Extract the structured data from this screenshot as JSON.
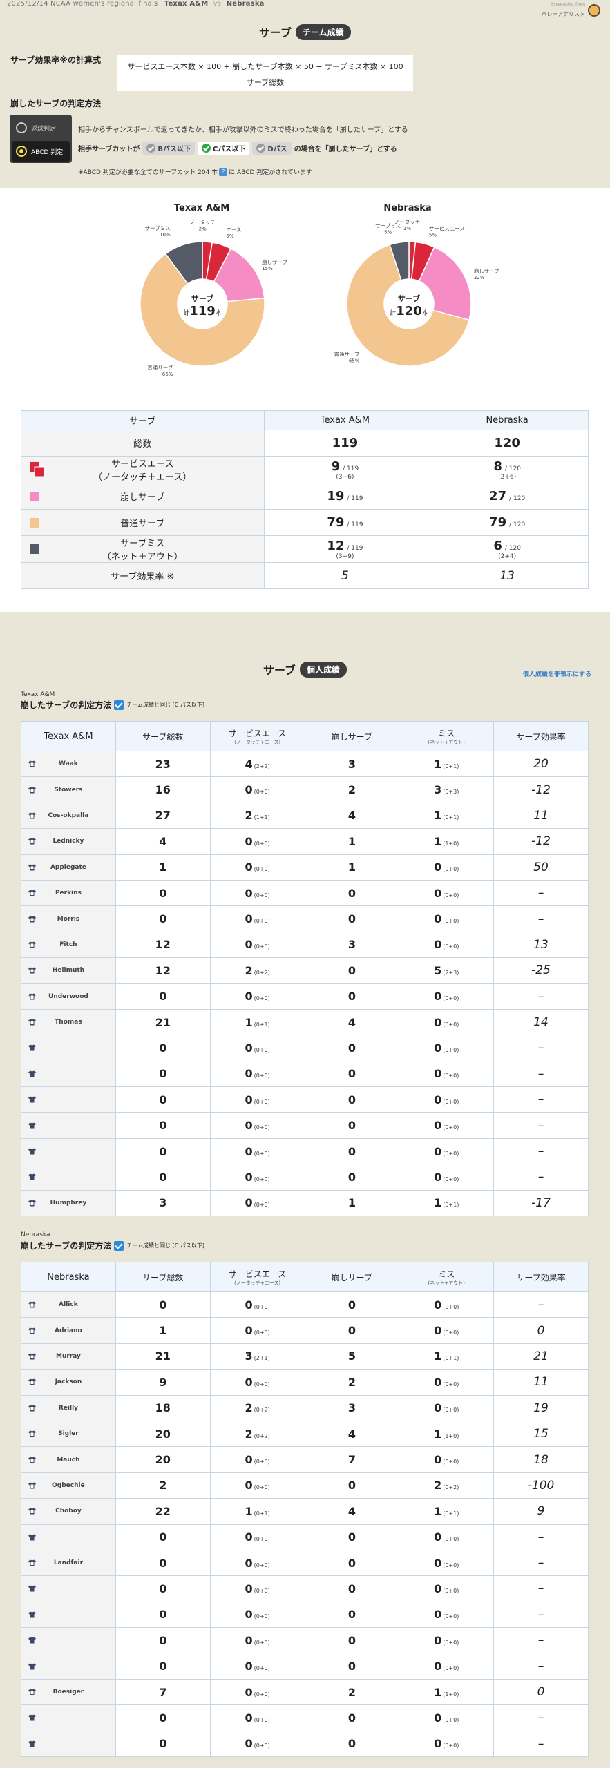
{
  "topbar": {
    "match": "2025/12/14 NCAA women's regional finals",
    "team_a": "Texax A&M",
    "vs": "vs",
    "team_b": "Nebraska"
  },
  "brand": {
    "small": "Screenshot from",
    "name": "バレーアナリスト"
  },
  "team_section": {
    "title": "サーブ",
    "badge": "チーム成績"
  },
  "formula": {
    "label": "サーブ効果率※の計算式",
    "numerator": "サービスエース本数 × 100 + 崩したサーブ本数 × 50 − サーブミス本数 × 100",
    "denominator": "サーブ総数"
  },
  "judge": {
    "label": "崩したサーブの判定方法",
    "modes": [
      "返球判定",
      "ABCD 判定"
    ],
    "active_mode": 1,
    "rule1": "相手からチャンスボールで返ってきたか、相手が攻撃以外のミスで終わった場合を「崩したサーブ」とする",
    "rule2_prefix": "相手サーブカットが",
    "chips": [
      "Bパス以下",
      "Cパス以下",
      "Dパス"
    ],
    "rule2_suffix": "の場合を「崩したサーブ」とする",
    "note_prefix": "※ABCD 判定が必要な全てのサーブカット 204 本",
    "note_icon": "?",
    "note_suffix": "に ABCD 判定がされています"
  },
  "colors": {
    "ace": "#d9263a",
    "break": "#f58dc4",
    "normal": "#f3c68f",
    "miss": "#545b67"
  },
  "pies": [
    {
      "team": "Texax A&M",
      "center_label": "サーブ",
      "total_prefix": "計",
      "total": "119",
      "total_suffix": "本",
      "chart_data": {
        "type": "pie",
        "categories": [
          "ノータッチ",
          "エース",
          "崩しサーブ",
          "普通サーブ",
          "サーブミス"
        ],
        "values": [
          3,
          6,
          19,
          79,
          12
        ]
      },
      "labels": [
        {
          "text": "ノータッチ",
          "pct": "2%"
        },
        {
          "text": "エース",
          "pct": "5%"
        },
        {
          "text": "崩しサーブ",
          "pct": "15%"
        },
        {
          "text": "普通サーブ",
          "pct": "66%"
        },
        {
          "text": "サーブミス",
          "pct": "10%"
        }
      ]
    },
    {
      "team": "Nebraska",
      "center_label": "サーブ",
      "total_prefix": "計",
      "total": "120",
      "total_suffix": "本",
      "chart_data": {
        "type": "pie",
        "categories": [
          "ノータッチ",
          "エース",
          "崩しサーブ",
          "普通サーブ",
          "サーブミス"
        ],
        "values": [
          2,
          6,
          27,
          79,
          6
        ]
      },
      "labels": [
        {
          "text": "ノータッチ",
          "pct": "1%"
        },
        {
          "text": "サービスエース",
          "pct": "5%"
        },
        {
          "text": "崩しサーブ",
          "pct": "22%"
        },
        {
          "text": "普通サーブ",
          "pct": "65%"
        },
        {
          "text": "サーブミス",
          "pct": "5%"
        }
      ]
    }
  ],
  "summary": {
    "headers": [
      "サーブ",
      "Texax A&M",
      "Nebraska"
    ],
    "rows": [
      {
        "label": "総数",
        "a": "119",
        "a_den": "",
        "a_sub": "",
        "b": "120",
        "b_den": "",
        "b_sub": "",
        "swatch": ""
      },
      {
        "label": "サービスエース",
        "label2": "（ノータッチ＋エース）",
        "a": "9",
        "a_den": "/ 119",
        "a_sub": "(3+6)",
        "b": "8",
        "b_den": "/ 120",
        "b_sub": "(2+6)",
        "swatch": "ace"
      },
      {
        "label": "崩しサーブ",
        "a": "19",
        "a_den": "/ 119",
        "a_sub": "",
        "b": "27",
        "b_den": "/ 120",
        "b_sub": "",
        "swatch": "break"
      },
      {
        "label": "普通サーブ",
        "a": "79",
        "a_den": "/ 119",
        "a_sub": "",
        "b": "79",
        "b_den": "/ 120",
        "b_sub": "",
        "swatch": "normal"
      },
      {
        "label": "サーブミス",
        "label2": "（ネット＋アウト）",
        "a": "12",
        "a_den": "/ 119",
        "a_sub": "(3+9)",
        "b": "6",
        "b_den": "/ 120",
        "b_sub": "(2+4)",
        "swatch": "miss"
      },
      {
        "label": "サーブ効果率 ※",
        "a": "5",
        "a_den": "",
        "a_sub": "",
        "b": "13",
        "b_den": "",
        "b_sub": "",
        "swatch": "",
        "italic": true
      }
    ]
  },
  "individual": {
    "title": "サーブ",
    "badge": "個人成績",
    "hide_link": "個人成績を非表示にする",
    "rule_label": "崩したサーブの判定方法",
    "checkbox_label": "チーム成績と同じ [C パス以下]",
    "col_headers": [
      "サーブ総数",
      "サービスエース",
      "崩しサーブ",
      "ミス",
      "サーブ効果率"
    ],
    "col_subs": [
      "",
      "(ノータッチ+エース)",
      "",
      "(ネット+アウト)",
      ""
    ],
    "teams": [
      {
        "caption": "Texax A&M",
        "header": "Texax A&M",
        "players": [
          {
            "name": "Waak",
            "total": "23",
            "ace": "4",
            "ace_s": "(2+2)",
            "brk": "3",
            "miss": "1",
            "miss_s": "(0+1)",
            "eff": "20"
          },
          {
            "name": "Stowers",
            "total": "16",
            "ace": "0",
            "ace_s": "(0+0)",
            "brk": "2",
            "miss": "3",
            "miss_s": "(0+3)",
            "eff": "-12"
          },
          {
            "name": "Cos-okpalla",
            "total": "27",
            "ace": "2",
            "ace_s": "(1+1)",
            "brk": "4",
            "miss": "1",
            "miss_s": "(0+1)",
            "eff": "11"
          },
          {
            "name": "Lednicky",
            "total": "4",
            "ace": "0",
            "ace_s": "(0+0)",
            "brk": "1",
            "miss": "1",
            "miss_s": "(1+0)",
            "eff": "-12"
          },
          {
            "name": "Applegate",
            "total": "1",
            "ace": "0",
            "ace_s": "(0+0)",
            "brk": "1",
            "miss": "0",
            "miss_s": "(0+0)",
            "eff": "50"
          },
          {
            "name": "Perkins",
            "total": "0",
            "ace": "0",
            "ace_s": "(0+0)",
            "brk": "0",
            "miss": "0",
            "miss_s": "(0+0)",
            "eff": "–"
          },
          {
            "name": "Morris",
            "total": "0",
            "ace": "0",
            "ace_s": "(0+0)",
            "brk": "0",
            "miss": "0",
            "miss_s": "(0+0)",
            "eff": "–"
          },
          {
            "name": "Fitch",
            "total": "12",
            "ace": "0",
            "ace_s": "(0+0)",
            "brk": "3",
            "miss": "0",
            "miss_s": "(0+0)",
            "eff": "13"
          },
          {
            "name": "Hellmuth",
            "total": "12",
            "ace": "2",
            "ace_s": "(0+2)",
            "brk": "0",
            "miss": "5",
            "miss_s": "(2+3)",
            "eff": "-25"
          },
          {
            "name": "Underwood",
            "total": "0",
            "ace": "0",
            "ace_s": "(0+0)",
            "brk": "0",
            "miss": "0",
            "miss_s": "(0+0)",
            "eff": "–"
          },
          {
            "name": "Thomas",
            "total": "21",
            "ace": "1",
            "ace_s": "(0+1)",
            "brk": "4",
            "miss": "0",
            "miss_s": "(0+0)",
            "eff": "14"
          },
          {
            "name": "",
            "total": "0",
            "ace": "0",
            "ace_s": "(0+0)",
            "brk": "0",
            "miss": "0",
            "miss_s": "(0+0)",
            "eff": "–"
          },
          {
            "name": "",
            "total": "0",
            "ace": "0",
            "ace_s": "(0+0)",
            "brk": "0",
            "miss": "0",
            "miss_s": "(0+0)",
            "eff": "–"
          },
          {
            "name": "",
            "total": "0",
            "ace": "0",
            "ace_s": "(0+0)",
            "brk": "0",
            "miss": "0",
            "miss_s": "(0+0)",
            "eff": "–"
          },
          {
            "name": "",
            "total": "0",
            "ace": "0",
            "ace_s": "(0+0)",
            "brk": "0",
            "miss": "0",
            "miss_s": "(0+0)",
            "eff": "–"
          },
          {
            "name": "",
            "total": "0",
            "ace": "0",
            "ace_s": "(0+0)",
            "brk": "0",
            "miss": "0",
            "miss_s": "(0+0)",
            "eff": "–"
          },
          {
            "name": "",
            "total": "0",
            "ace": "0",
            "ace_s": "(0+0)",
            "brk": "0",
            "miss": "0",
            "miss_s": "(0+0)",
            "eff": "–"
          },
          {
            "name": "Humphrey",
            "total": "3",
            "ace": "0",
            "ace_s": "(0+0)",
            "brk": "1",
            "miss": "1",
            "miss_s": "(0+1)",
            "eff": "-17"
          }
        ]
      },
      {
        "caption": "Nebraska",
        "header": "Nebraska",
        "players": [
          {
            "name": "Allick",
            "total": "0",
            "ace": "0",
            "ace_s": "(0+0)",
            "brk": "0",
            "miss": "0",
            "miss_s": "(0+0)",
            "eff": "–"
          },
          {
            "name": "Adriano",
            "total": "1",
            "ace": "0",
            "ace_s": "(0+0)",
            "brk": "0",
            "miss": "0",
            "miss_s": "(0+0)",
            "eff": "0"
          },
          {
            "name": "Murray",
            "total": "21",
            "ace": "3",
            "ace_s": "(2+1)",
            "brk": "5",
            "miss": "1",
            "miss_s": "(0+1)",
            "eff": "21"
          },
          {
            "name": "Jackson",
            "total": "9",
            "ace": "0",
            "ace_s": "(0+0)",
            "brk": "2",
            "miss": "0",
            "miss_s": "(0+0)",
            "eff": "11"
          },
          {
            "name": "Reilly",
            "total": "18",
            "ace": "2",
            "ace_s": "(0+2)",
            "brk": "3",
            "miss": "0",
            "miss_s": "(0+0)",
            "eff": "19"
          },
          {
            "name": "Sigler",
            "total": "20",
            "ace": "2",
            "ace_s": "(0+2)",
            "brk": "4",
            "miss": "1",
            "miss_s": "(1+0)",
            "eff": "15"
          },
          {
            "name": "Mauch",
            "total": "20",
            "ace": "0",
            "ace_s": "(0+0)",
            "brk": "7",
            "miss": "0",
            "miss_s": "(0+0)",
            "eff": "18"
          },
          {
            "name": "Ogbechie",
            "total": "2",
            "ace": "0",
            "ace_s": "(0+0)",
            "brk": "0",
            "miss": "2",
            "miss_s": "(0+2)",
            "eff": "-100"
          },
          {
            "name": "Choboy",
            "total": "22",
            "ace": "1",
            "ace_s": "(0+1)",
            "brk": "4",
            "miss": "1",
            "miss_s": "(0+1)",
            "eff": "9"
          },
          {
            "name": "",
            "total": "0",
            "ace": "0",
            "ace_s": "(0+0)",
            "brk": "0",
            "miss": "0",
            "miss_s": "(0+0)",
            "eff": "–"
          },
          {
            "name": "Landfair",
            "total": "0",
            "ace": "0",
            "ace_s": "(0+0)",
            "brk": "0",
            "miss": "0",
            "miss_s": "(0+0)",
            "eff": "–"
          },
          {
            "name": "",
            "total": "0",
            "ace": "0",
            "ace_s": "(0+0)",
            "brk": "0",
            "miss": "0",
            "miss_s": "(0+0)",
            "eff": "–"
          },
          {
            "name": "",
            "total": "0",
            "ace": "0",
            "ace_s": "(0+0)",
            "brk": "0",
            "miss": "0",
            "miss_s": "(0+0)",
            "eff": "–"
          },
          {
            "name": "",
            "total": "0",
            "ace": "0",
            "ace_s": "(0+0)",
            "brk": "0",
            "miss": "0",
            "miss_s": "(0+0)",
            "eff": "–"
          },
          {
            "name": "",
            "total": "0",
            "ace": "0",
            "ace_s": "(0+0)",
            "brk": "0",
            "miss": "0",
            "miss_s": "(0+0)",
            "eff": "–"
          },
          {
            "name": "Boesiger",
            "total": "7",
            "ace": "0",
            "ace_s": "(0+0)",
            "brk": "2",
            "miss": "1",
            "miss_s": "(1+0)",
            "eff": "0"
          },
          {
            "name": "",
            "total": "0",
            "ace": "0",
            "ace_s": "(0+0)",
            "brk": "0",
            "miss": "0",
            "miss_s": "(0+0)",
            "eff": "–"
          },
          {
            "name": "",
            "total": "0",
            "ace": "0",
            "ace_s": "(0+0)",
            "brk": "0",
            "miss": "0",
            "miss_s": "(0+0)",
            "eff": "–"
          }
        ]
      }
    ]
  }
}
